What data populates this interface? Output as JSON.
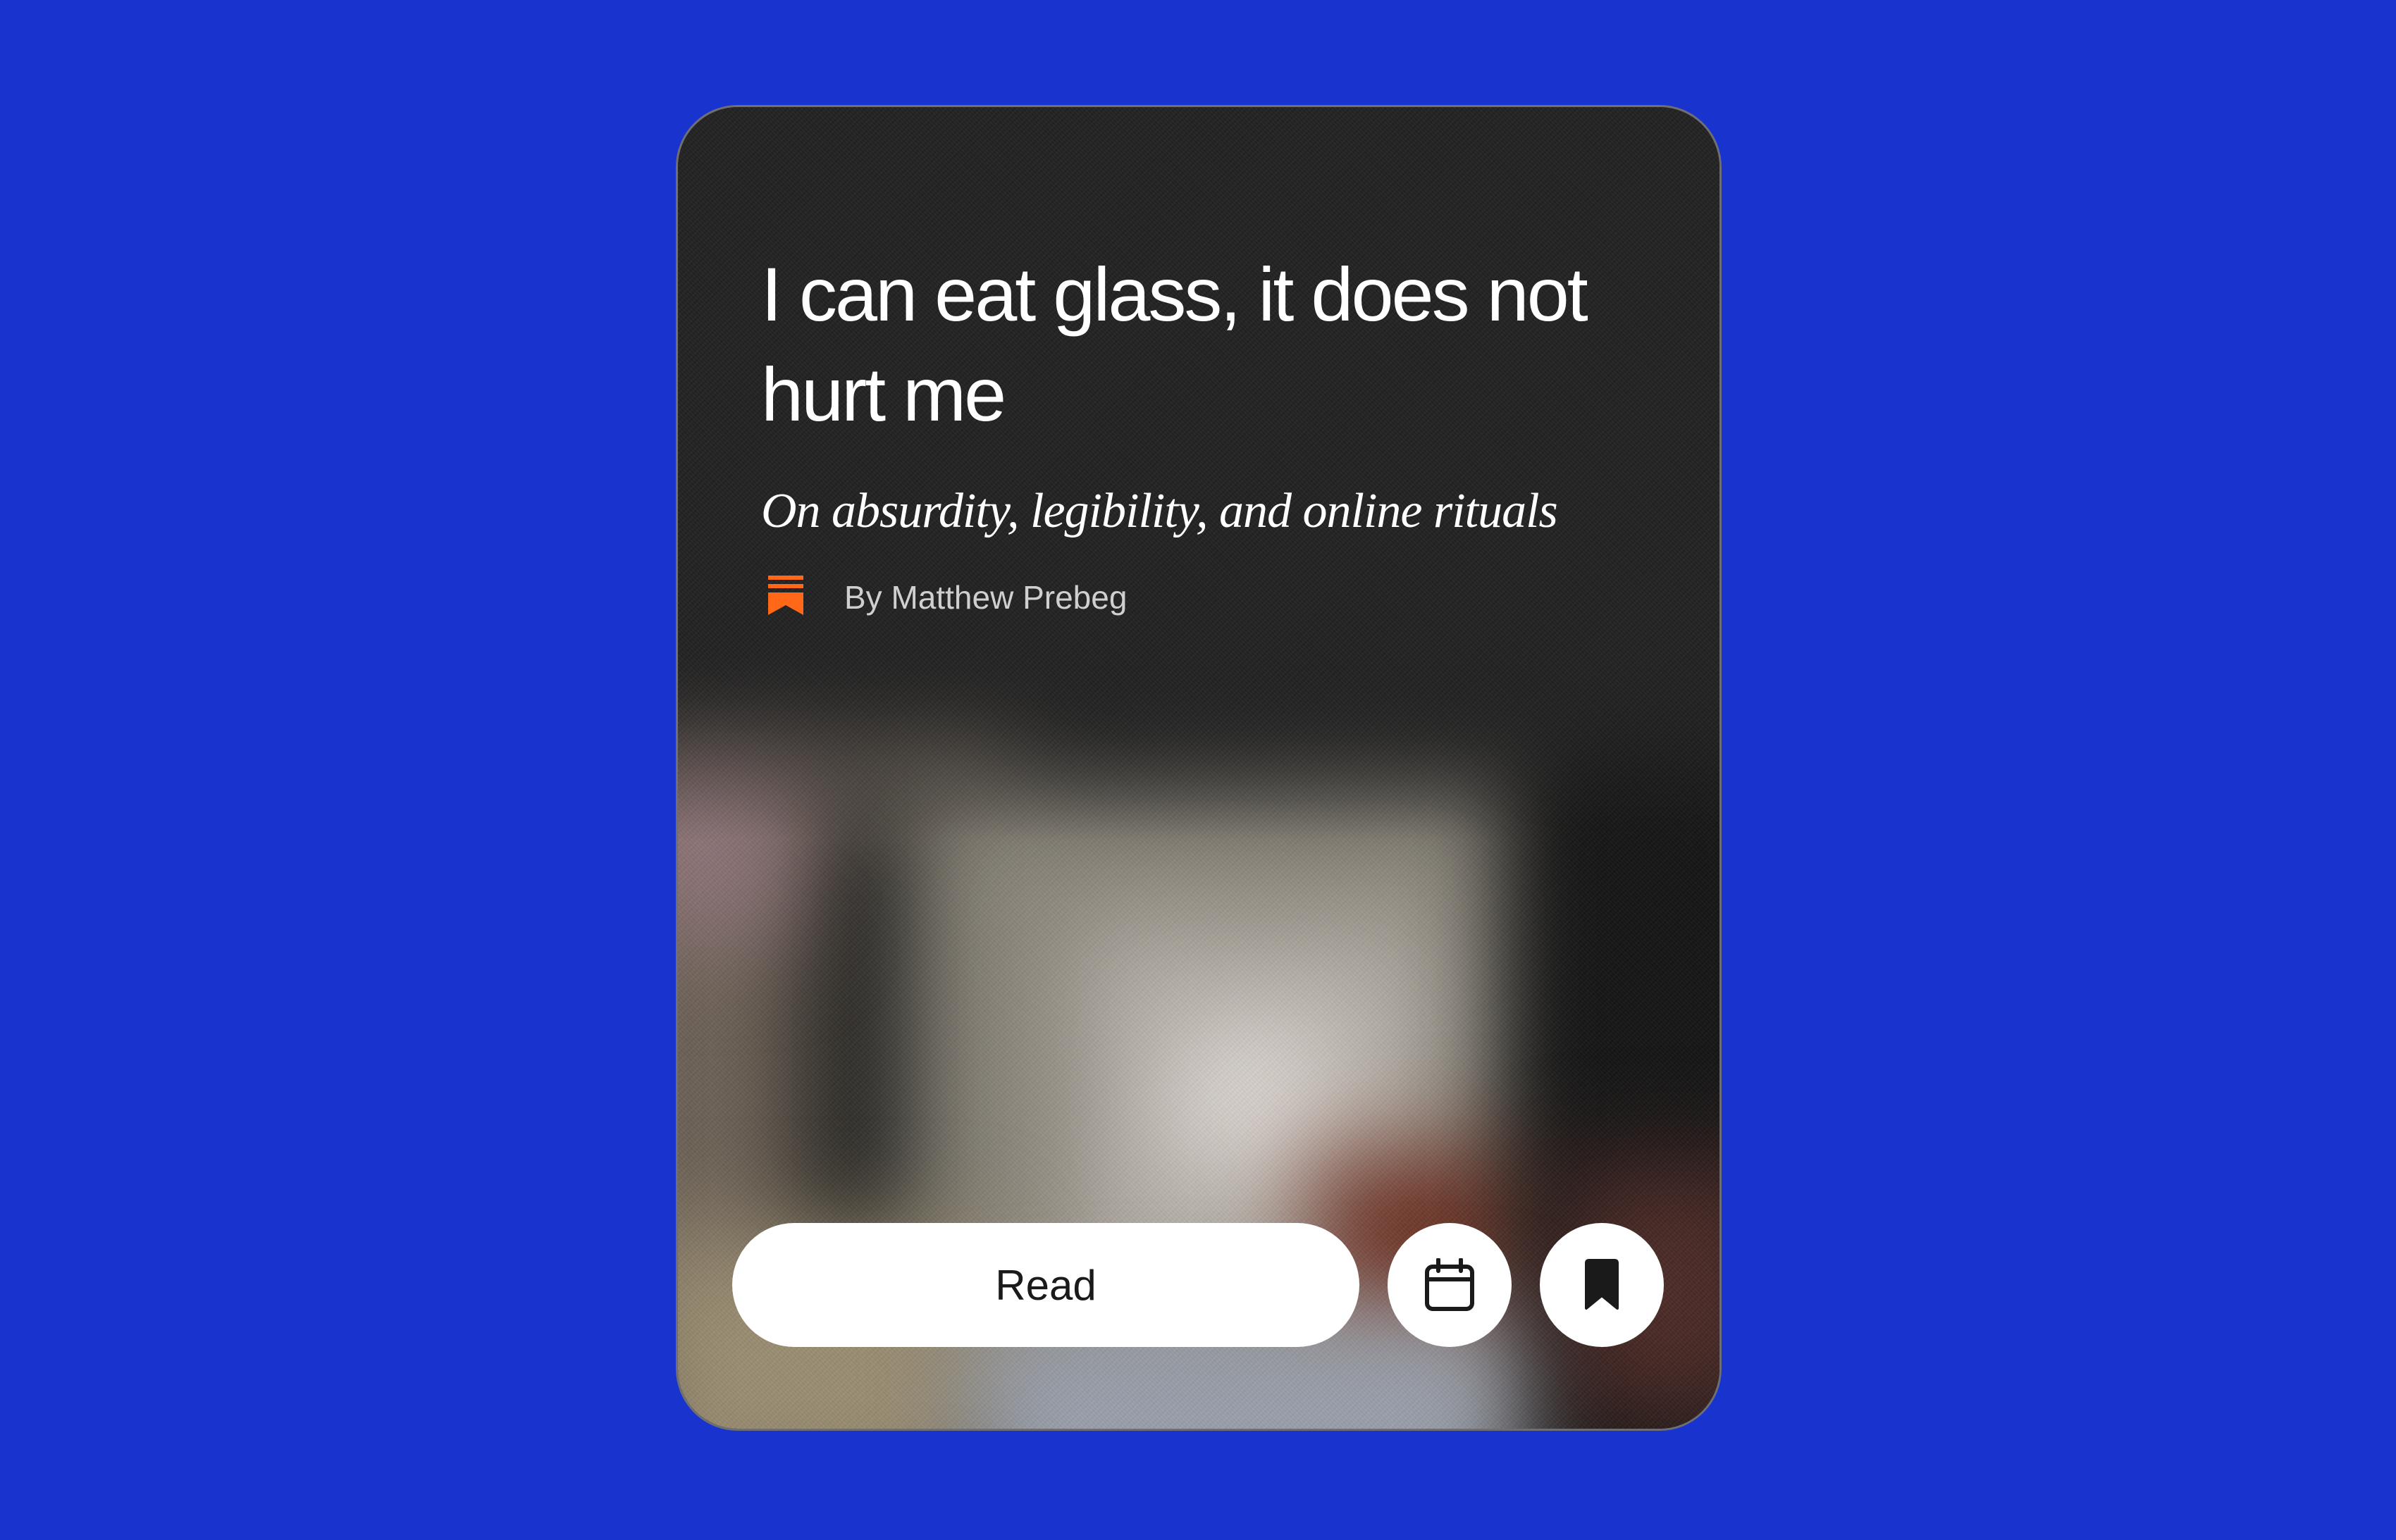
{
  "article": {
    "title": "I can eat glass, it does not hurt me",
    "subtitle": "On absurdity, legibility, and online rituals",
    "author": "By Matthew Prebeg",
    "publisher_icon": "substack-logo-icon"
  },
  "actions": {
    "read_label": "Read",
    "schedule_icon": "calendar-icon",
    "save_icon": "bookmark-icon"
  },
  "colors": {
    "background": "#1833CE",
    "card": "#222222",
    "accent": "#FF6719",
    "button": "#FFFFFF"
  }
}
